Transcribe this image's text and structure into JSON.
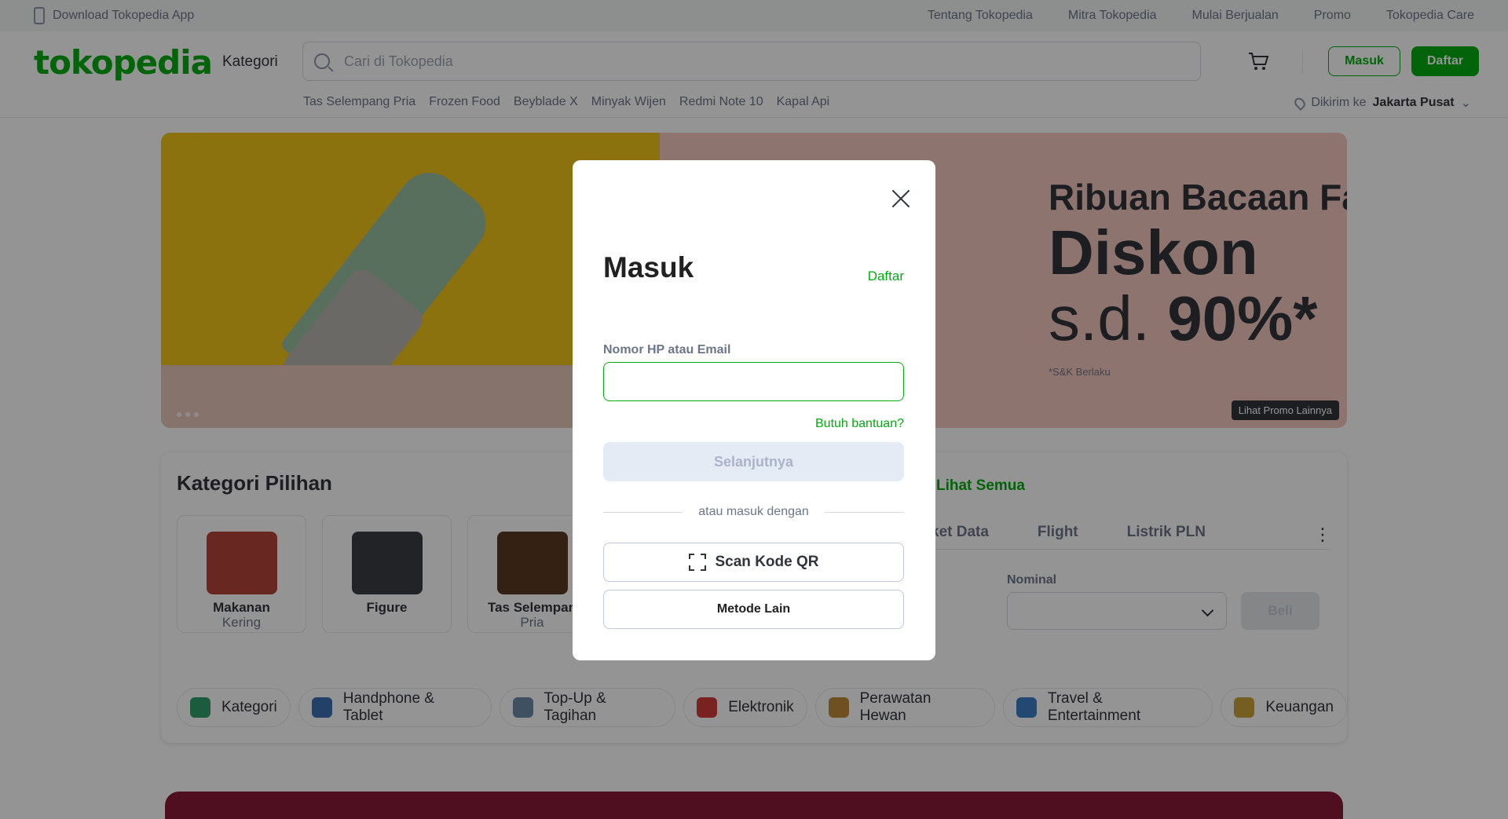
{
  "topbar": {
    "download_app": "Download Tokopedia App",
    "links": [
      "Tentang Tokopedia",
      "Mitra Tokopedia",
      "Mulai Berjualan",
      "Promo",
      "Tokopedia Care"
    ]
  },
  "header": {
    "logo": "tokopedia",
    "kategori": "Kategori",
    "search_placeholder": "Cari di Tokopedia",
    "masuk": "Masuk",
    "daftar": "Daftar",
    "chips": [
      "Tas Selempang Pria",
      "Frozen Food",
      "Beyblade X",
      "Minyak Wijen",
      "Redmi Note 10",
      "Kapal Api"
    ],
    "deliver_prefix": "Dikirim ke",
    "deliver_location": "Jakarta Pusat"
  },
  "banner": {
    "line1": "Ribuan Bacaan Fa",
    "line2": "Diskon",
    "line3_prefix": "s.d.",
    "line3_value": "90%*",
    "note": "*S&K Berlaku",
    "promo_link": "Lihat Promo Lainnya"
  },
  "categories": {
    "title": "Kategori Pilihan",
    "cards": [
      {
        "label": "Makanan",
        "sub": "Kering"
      },
      {
        "label": "Figure",
        "sub": ""
      },
      {
        "label": "Tas Selempan",
        "sub": "Pria"
      }
    ],
    "lihat_semua": "Lihat Semua",
    "topup_tabs": [
      "ket Data",
      "Flight",
      "Listrik PLN"
    ],
    "nominal_label": "Nominal",
    "beli": "Beli",
    "pills": [
      "Kategori",
      "Handphone & Tablet",
      "Top-Up & Tagihan",
      "Elektronik",
      "Perawatan Hewan",
      "Travel & Entertainment",
      "Keuangan"
    ]
  },
  "modal": {
    "title": "Masuk",
    "daftar_link": "Daftar",
    "field_label": "Nomor HP atau Email",
    "field_value": "",
    "help": "Butuh bantuan?",
    "next": "Selanjutnya",
    "or_text": "atau masuk dengan",
    "scan_qr": "Scan Kode QR",
    "other_method": "Metode Lain"
  },
  "colors": {
    "brand_green": "#03ac0e",
    "overlay": "rgba(0,0,0,0.42)"
  }
}
